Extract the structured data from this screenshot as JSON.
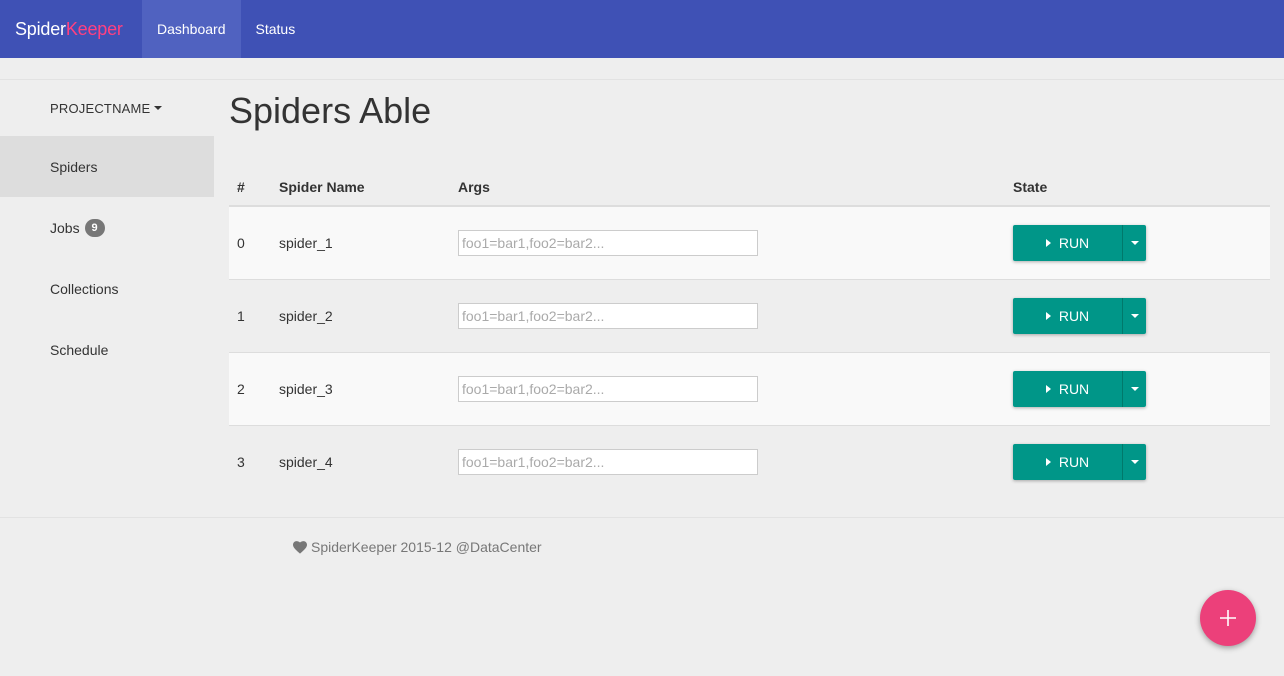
{
  "brand": {
    "part1": "Spider",
    "part2": "Keeper"
  },
  "nav": {
    "dashboard": "Dashboard",
    "status": "Status"
  },
  "sidebar": {
    "project": "PROJECTNAME",
    "items": [
      {
        "label": "Spiders",
        "active": true
      },
      {
        "label": "Jobs",
        "badge": "9"
      },
      {
        "label": "Collections"
      },
      {
        "label": "Schedule"
      }
    ]
  },
  "main": {
    "title": "Spiders Able"
  },
  "table": {
    "headers": [
      "#",
      "Spider Name",
      "Args",
      "State"
    ],
    "rows": [
      {
        "index": "0",
        "name": "spider_1",
        "args_value": "",
        "args_placeholder": "foo1=bar1,foo2=bar2..."
      },
      {
        "index": "1",
        "name": "spider_2",
        "args_value": "",
        "args_placeholder": "foo1=bar1,foo2=bar2..."
      },
      {
        "index": "2",
        "name": "spider_3",
        "args_value": "",
        "args_placeholder": "foo1=bar1,foo2=bar2..."
      },
      {
        "index": "3",
        "name": "spider_4",
        "args_value": "",
        "args_placeholder": "foo1=bar1,foo2=bar2..."
      }
    ],
    "run_label": "RUN"
  },
  "footer": {
    "text": "SpiderKeeper 2015-12 @DataCenter"
  },
  "icons": {
    "footer": "heart-icon",
    "fab": "plus-icon",
    "run": "play-icon"
  },
  "colors": {
    "navbar": "#3f51b5",
    "brand_accent": "#ff4081",
    "run_button": "#009688",
    "fab": "#ec407a"
  }
}
